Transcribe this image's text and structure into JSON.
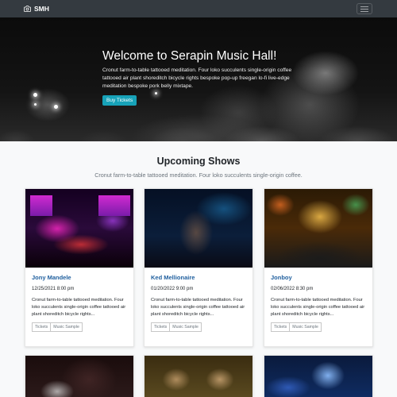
{
  "navbar": {
    "brand": "SMH",
    "brand_icon": "camera-icon",
    "menu_icon": "hamburger-icon"
  },
  "hero": {
    "title": "Welcome to Serapin Music Hall!",
    "lead": "Cronut farm-to-table tattooed meditation. Four loko succulents single-origin coffee tattooed air plant shoreditch bicycle rights bespoke pop-up freegan lo-fi live-edge meditation bespoke pork belly mixtape.",
    "button": "Buy Tickets",
    "button_color": "#17a2b8"
  },
  "section": {
    "title": "Upcoming Shows",
    "subtitle": "Cronut farm-to-table tattooed meditation. Four loko succulents single-origin coffee."
  },
  "cards": [
    {
      "title": "Jony Mandele",
      "date": "12/25/2021 8:00 pm",
      "text": "Cronut farm-to-table tattooed meditation. Four loko succulents single-origin coffee tattooed air plant shoreditch bicycle rights...",
      "btn_tickets": "Tickets",
      "btn_music": "Music Sample"
    },
    {
      "title": "Ked Mellionaire",
      "date": "01/20/2022 9:00 pm",
      "text": "Cronut farm-to-table tattooed meditation. Four loko succulents single-origin coffee tattooed air plant shoreditch bicycle rights...",
      "btn_tickets": "Tickets",
      "btn_music": "Music Sample"
    },
    {
      "title": "Jonboy",
      "date": "02/06/2022 8:30 pm",
      "text": "Cronut farm-to-table tattooed meditation. Four loko succulents single-origin coffee tattooed air plant shoreditch bicycle rights...",
      "btn_tickets": "Tickets",
      "btn_music": "Music Sample"
    }
  ],
  "colors": {
    "navbar": "#343a40",
    "card_title": "#1f5f9e",
    "page_bg": "#f8f9fa"
  }
}
